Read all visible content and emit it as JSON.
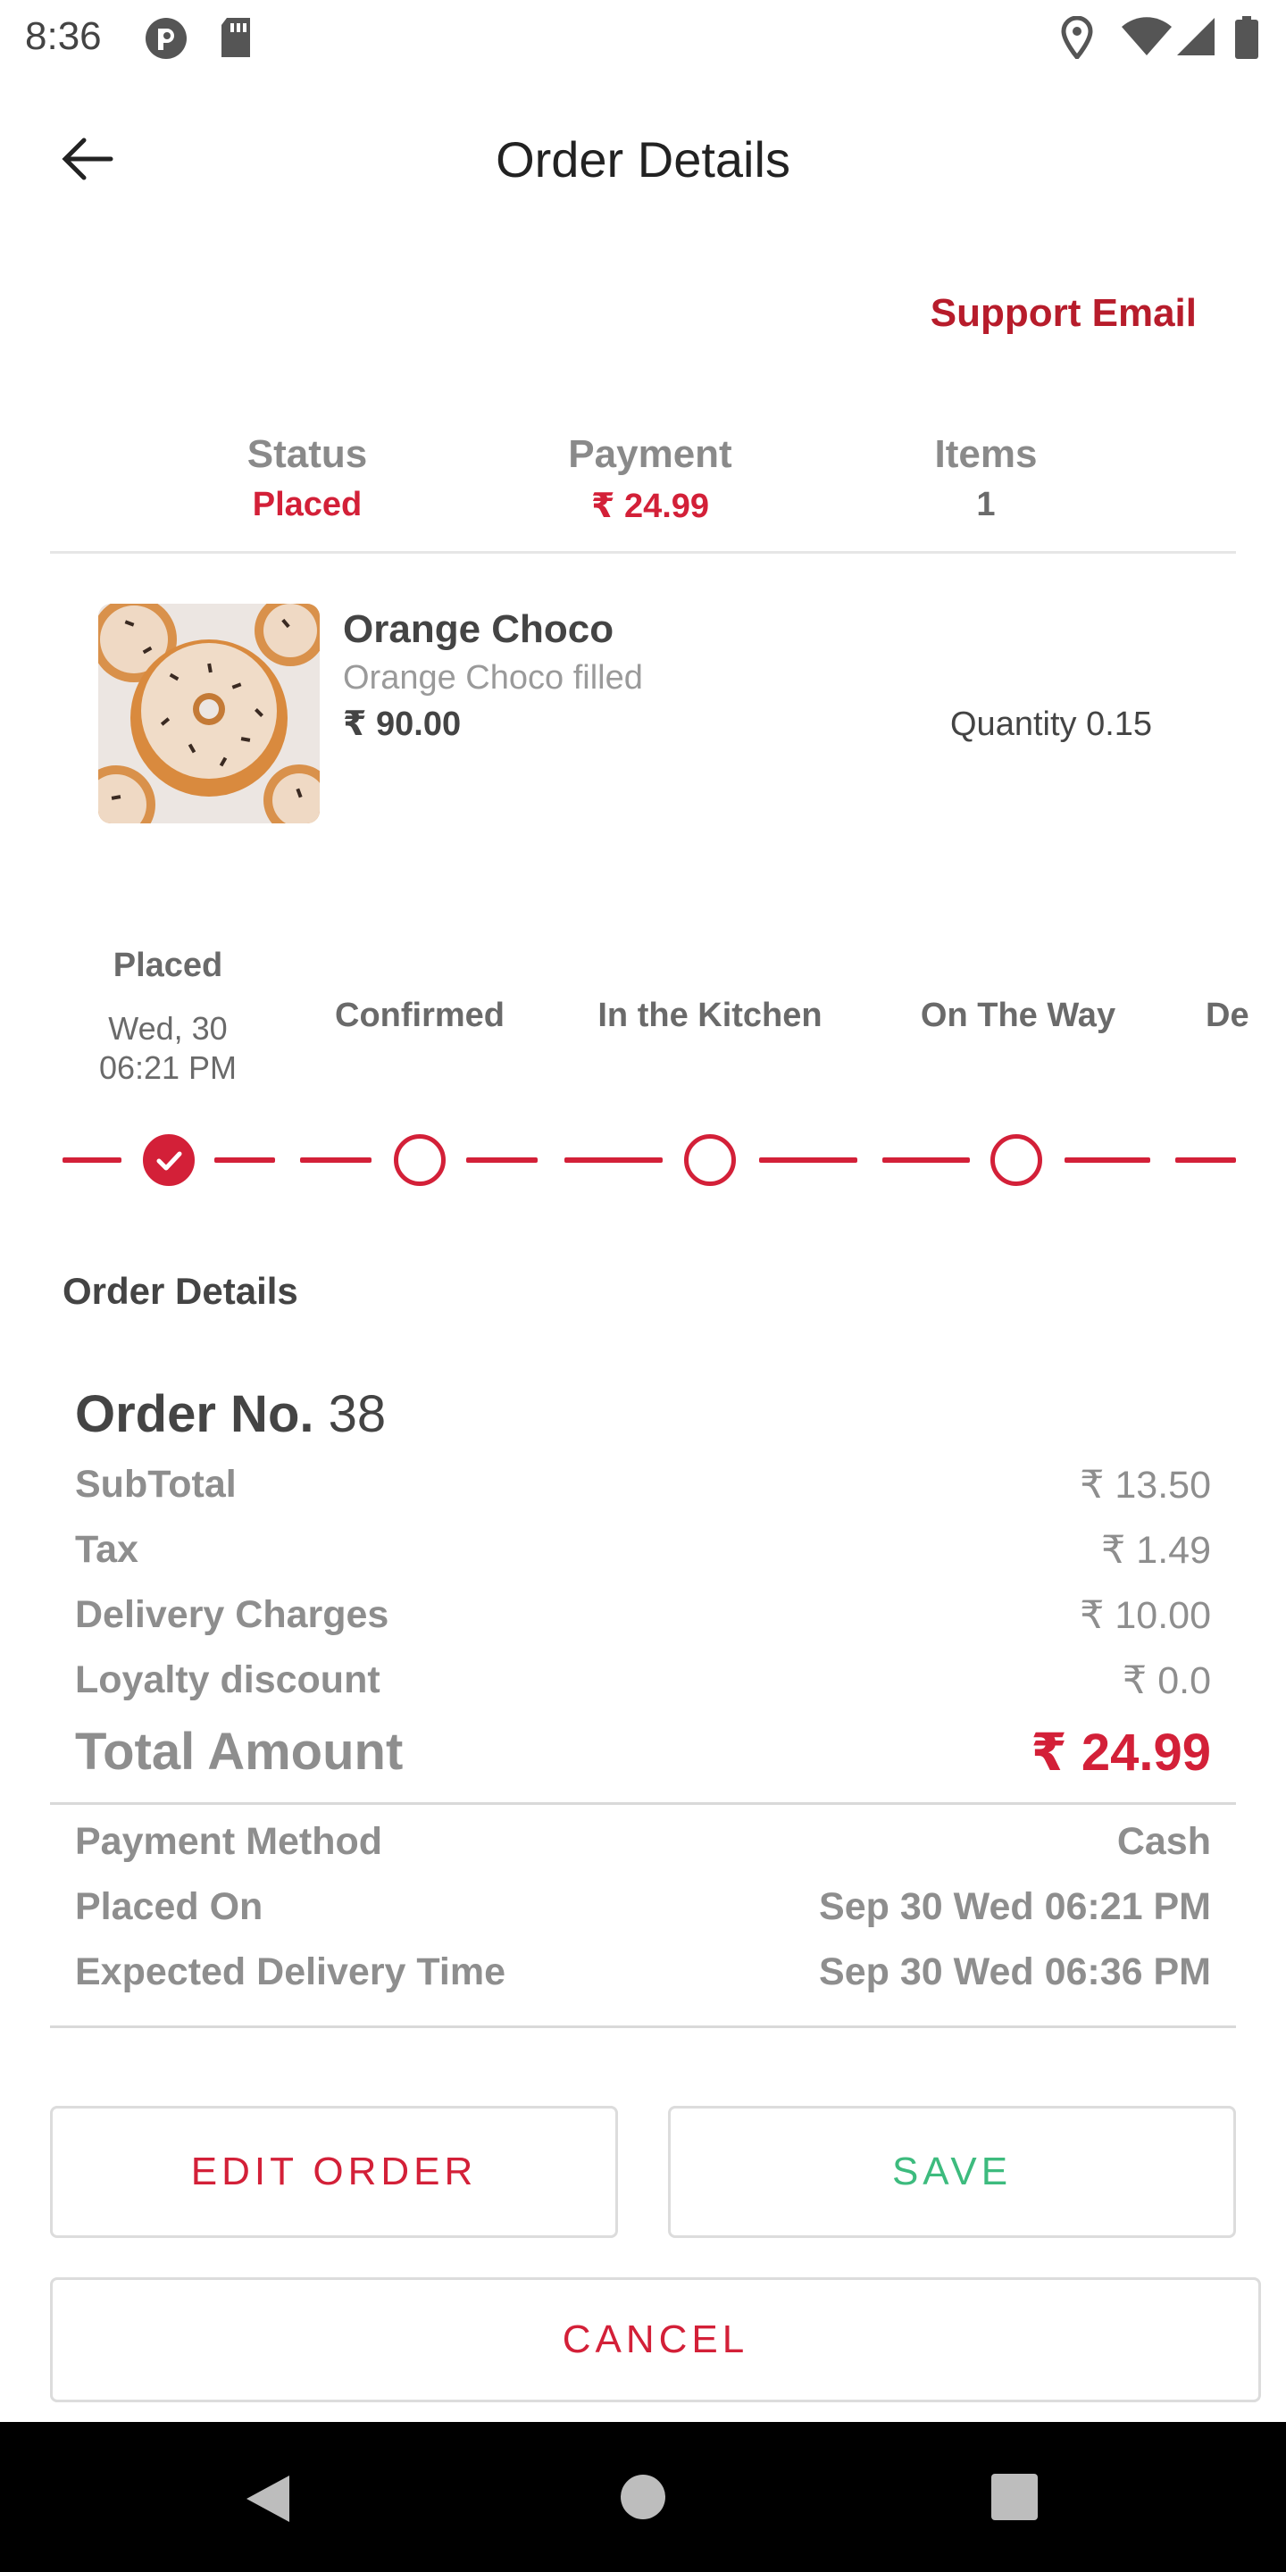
{
  "statusbar": {
    "time": "8:36"
  },
  "header": {
    "title": "Order Details"
  },
  "support": {
    "label": "Support Email"
  },
  "summary": {
    "status_label": "Status",
    "status_value": "Placed",
    "payment_label": "Payment",
    "payment_value": "₹ 24.99",
    "items_label": "Items",
    "items_value": "1"
  },
  "item": {
    "name": "Orange Choco",
    "description": "Orange Choco filled",
    "price": "₹ 90.00",
    "quantity": "Quantity 0.15"
  },
  "progress": {
    "steps": [
      {
        "label": "Placed",
        "date": "Wed, 30",
        "time": "06:21 PM",
        "done": true
      },
      {
        "label": "Confirmed",
        "done": false
      },
      {
        "label": "In the Kitchen",
        "done": false
      },
      {
        "label": "On The Way",
        "done": false
      },
      {
        "label": "De",
        "done": false
      }
    ]
  },
  "details": {
    "section_title": "Order Details",
    "order_no_label": "Order No.",
    "order_no": "38",
    "subtotal_label": "SubTotal",
    "subtotal": "₹ 13.50",
    "tax_label": "Tax",
    "tax": "₹ 1.49",
    "delivery_label": "Delivery Charges",
    "delivery": "₹ 10.00",
    "loyalty_label": "Loyalty discount",
    "loyalty": "₹ 0.0",
    "total_label": "Total Amount",
    "total": "₹ 24.99",
    "payment_method_label": "Payment Method",
    "payment_method": "Cash",
    "placed_on_label": "Placed On",
    "placed_on": "Sep 30 Wed 06:21 PM",
    "expected_label": "Expected Delivery Time",
    "expected": "Sep 30 Wed 06:36 PM"
  },
  "actions": {
    "edit_label": "EDIT ORDER",
    "save_label": "SAVE",
    "cancel_label": "CANCEL"
  },
  "colors": {
    "accent": "#d32038",
    "brand_dark": "#b71c2b",
    "save_green": "#3dbb7e"
  }
}
